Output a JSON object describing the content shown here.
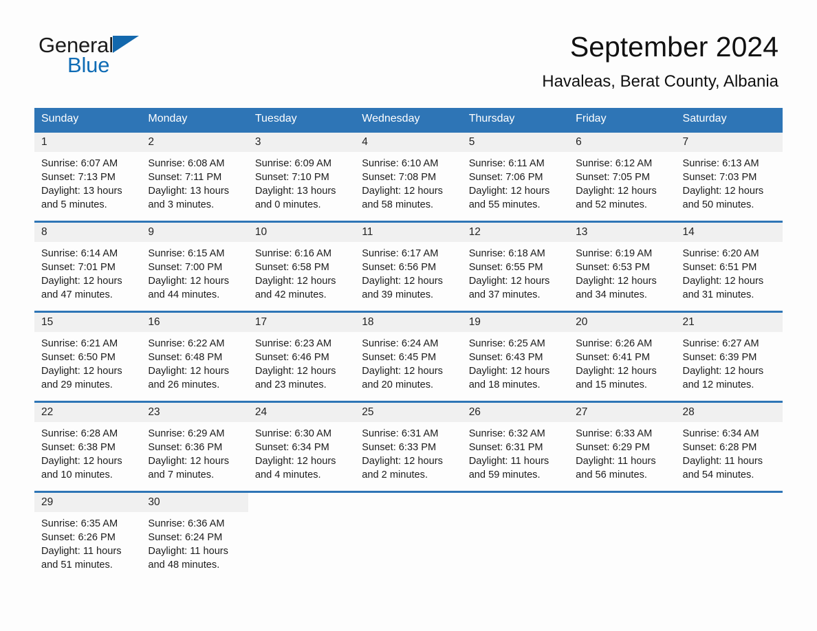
{
  "brand": {
    "word_general": "General",
    "word_blue": "Blue",
    "accent_color": "#2e75b6",
    "logo_blue": "#0f6cb5"
  },
  "header": {
    "title": "September 2024",
    "subtitle": "Havaleas, Berat County, Albania"
  },
  "calendar": {
    "weekday_headers": [
      "Sunday",
      "Monday",
      "Tuesday",
      "Wednesday",
      "Thursday",
      "Friday",
      "Saturday"
    ],
    "weeks": [
      [
        {
          "day": "1",
          "sunrise": "Sunrise: 6:07 AM",
          "sunset": "Sunset: 7:13 PM",
          "daylight_line1": "Daylight: 13 hours",
          "daylight_line2": "and 5 minutes."
        },
        {
          "day": "2",
          "sunrise": "Sunrise: 6:08 AM",
          "sunset": "Sunset: 7:11 PM",
          "daylight_line1": "Daylight: 13 hours",
          "daylight_line2": "and 3 minutes."
        },
        {
          "day": "3",
          "sunrise": "Sunrise: 6:09 AM",
          "sunset": "Sunset: 7:10 PM",
          "daylight_line1": "Daylight: 13 hours",
          "daylight_line2": "and 0 minutes."
        },
        {
          "day": "4",
          "sunrise": "Sunrise: 6:10 AM",
          "sunset": "Sunset: 7:08 PM",
          "daylight_line1": "Daylight: 12 hours",
          "daylight_line2": "and 58 minutes."
        },
        {
          "day": "5",
          "sunrise": "Sunrise: 6:11 AM",
          "sunset": "Sunset: 7:06 PM",
          "daylight_line1": "Daylight: 12 hours",
          "daylight_line2": "and 55 minutes."
        },
        {
          "day": "6",
          "sunrise": "Sunrise: 6:12 AM",
          "sunset": "Sunset: 7:05 PM",
          "daylight_line1": "Daylight: 12 hours",
          "daylight_line2": "and 52 minutes."
        },
        {
          "day": "7",
          "sunrise": "Sunrise: 6:13 AM",
          "sunset": "Sunset: 7:03 PM",
          "daylight_line1": "Daylight: 12 hours",
          "daylight_line2": "and 50 minutes."
        }
      ],
      [
        {
          "day": "8",
          "sunrise": "Sunrise: 6:14 AM",
          "sunset": "Sunset: 7:01 PM",
          "daylight_line1": "Daylight: 12 hours",
          "daylight_line2": "and 47 minutes."
        },
        {
          "day": "9",
          "sunrise": "Sunrise: 6:15 AM",
          "sunset": "Sunset: 7:00 PM",
          "daylight_line1": "Daylight: 12 hours",
          "daylight_line2": "and 44 minutes."
        },
        {
          "day": "10",
          "sunrise": "Sunrise: 6:16 AM",
          "sunset": "Sunset: 6:58 PM",
          "daylight_line1": "Daylight: 12 hours",
          "daylight_line2": "and 42 minutes."
        },
        {
          "day": "11",
          "sunrise": "Sunrise: 6:17 AM",
          "sunset": "Sunset: 6:56 PM",
          "daylight_line1": "Daylight: 12 hours",
          "daylight_line2": "and 39 minutes."
        },
        {
          "day": "12",
          "sunrise": "Sunrise: 6:18 AM",
          "sunset": "Sunset: 6:55 PM",
          "daylight_line1": "Daylight: 12 hours",
          "daylight_line2": "and 37 minutes."
        },
        {
          "day": "13",
          "sunrise": "Sunrise: 6:19 AM",
          "sunset": "Sunset: 6:53 PM",
          "daylight_line1": "Daylight: 12 hours",
          "daylight_line2": "and 34 minutes."
        },
        {
          "day": "14",
          "sunrise": "Sunrise: 6:20 AM",
          "sunset": "Sunset: 6:51 PM",
          "daylight_line1": "Daylight: 12 hours",
          "daylight_line2": "and 31 minutes."
        }
      ],
      [
        {
          "day": "15",
          "sunrise": "Sunrise: 6:21 AM",
          "sunset": "Sunset: 6:50 PM",
          "daylight_line1": "Daylight: 12 hours",
          "daylight_line2": "and 29 minutes."
        },
        {
          "day": "16",
          "sunrise": "Sunrise: 6:22 AM",
          "sunset": "Sunset: 6:48 PM",
          "daylight_line1": "Daylight: 12 hours",
          "daylight_line2": "and 26 minutes."
        },
        {
          "day": "17",
          "sunrise": "Sunrise: 6:23 AM",
          "sunset": "Sunset: 6:46 PM",
          "daylight_line1": "Daylight: 12 hours",
          "daylight_line2": "and 23 minutes."
        },
        {
          "day": "18",
          "sunrise": "Sunrise: 6:24 AM",
          "sunset": "Sunset: 6:45 PM",
          "daylight_line1": "Daylight: 12 hours",
          "daylight_line2": "and 20 minutes."
        },
        {
          "day": "19",
          "sunrise": "Sunrise: 6:25 AM",
          "sunset": "Sunset: 6:43 PM",
          "daylight_line1": "Daylight: 12 hours",
          "daylight_line2": "and 18 minutes."
        },
        {
          "day": "20",
          "sunrise": "Sunrise: 6:26 AM",
          "sunset": "Sunset: 6:41 PM",
          "daylight_line1": "Daylight: 12 hours",
          "daylight_line2": "and 15 minutes."
        },
        {
          "day": "21",
          "sunrise": "Sunrise: 6:27 AM",
          "sunset": "Sunset: 6:39 PM",
          "daylight_line1": "Daylight: 12 hours",
          "daylight_line2": "and 12 minutes."
        }
      ],
      [
        {
          "day": "22",
          "sunrise": "Sunrise: 6:28 AM",
          "sunset": "Sunset: 6:38 PM",
          "daylight_line1": "Daylight: 12 hours",
          "daylight_line2": "and 10 minutes."
        },
        {
          "day": "23",
          "sunrise": "Sunrise: 6:29 AM",
          "sunset": "Sunset: 6:36 PM",
          "daylight_line1": "Daylight: 12 hours",
          "daylight_line2": "and 7 minutes."
        },
        {
          "day": "24",
          "sunrise": "Sunrise: 6:30 AM",
          "sunset": "Sunset: 6:34 PM",
          "daylight_line1": "Daylight: 12 hours",
          "daylight_line2": "and 4 minutes."
        },
        {
          "day": "25",
          "sunrise": "Sunrise: 6:31 AM",
          "sunset": "Sunset: 6:33 PM",
          "daylight_line1": "Daylight: 12 hours",
          "daylight_line2": "and 2 minutes."
        },
        {
          "day": "26",
          "sunrise": "Sunrise: 6:32 AM",
          "sunset": "Sunset: 6:31 PM",
          "daylight_line1": "Daylight: 11 hours",
          "daylight_line2": "and 59 minutes."
        },
        {
          "day": "27",
          "sunrise": "Sunrise: 6:33 AM",
          "sunset": "Sunset: 6:29 PM",
          "daylight_line1": "Daylight: 11 hours",
          "daylight_line2": "and 56 minutes."
        },
        {
          "day": "28",
          "sunrise": "Sunrise: 6:34 AM",
          "sunset": "Sunset: 6:28 PM",
          "daylight_line1": "Daylight: 11 hours",
          "daylight_line2": "and 54 minutes."
        }
      ],
      [
        {
          "day": "29",
          "sunrise": "Sunrise: 6:35 AM",
          "sunset": "Sunset: 6:26 PM",
          "daylight_line1": "Daylight: 11 hours",
          "daylight_line2": "and 51 minutes."
        },
        {
          "day": "30",
          "sunrise": "Sunrise: 6:36 AM",
          "sunset": "Sunset: 6:24 PM",
          "daylight_line1": "Daylight: 11 hours",
          "daylight_line2": "and 48 minutes."
        },
        {
          "day": "",
          "sunrise": "",
          "sunset": "",
          "daylight_line1": "",
          "daylight_line2": ""
        },
        {
          "day": "",
          "sunrise": "",
          "sunset": "",
          "daylight_line1": "",
          "daylight_line2": ""
        },
        {
          "day": "",
          "sunrise": "",
          "sunset": "",
          "daylight_line1": "",
          "daylight_line2": ""
        },
        {
          "day": "",
          "sunrise": "",
          "sunset": "",
          "daylight_line1": "",
          "daylight_line2": ""
        },
        {
          "day": "",
          "sunrise": "",
          "sunset": "",
          "daylight_line1": "",
          "daylight_line2": ""
        }
      ]
    ]
  }
}
